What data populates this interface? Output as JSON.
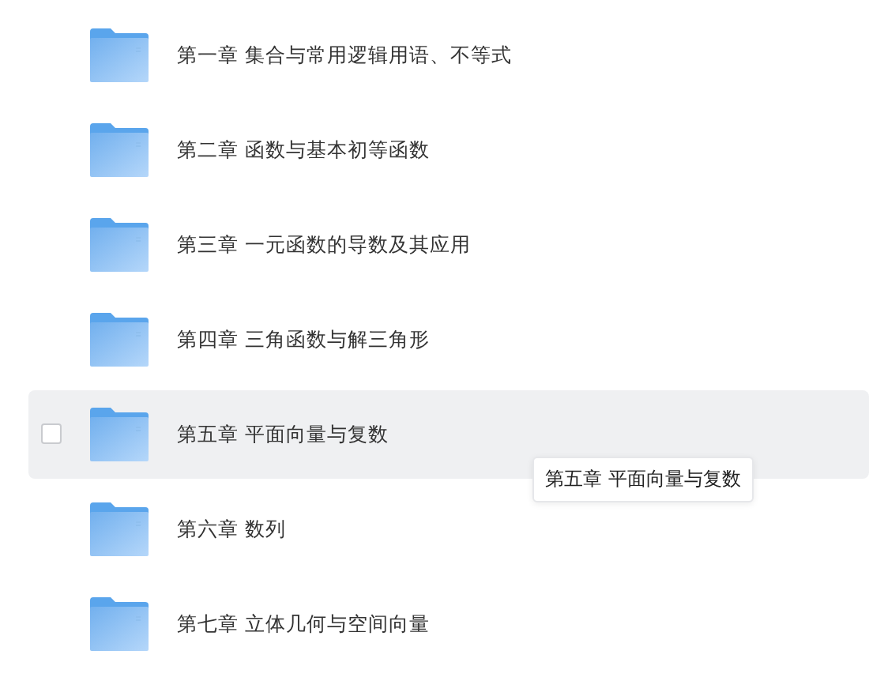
{
  "folders": [
    {
      "name": "第一章 集合与常用逻辑用语、不等式",
      "hovered": false
    },
    {
      "name": "第二章 函数与基本初等函数",
      "hovered": false
    },
    {
      "name": "第三章 一元函数的导数及其应用",
      "hovered": false
    },
    {
      "name": "第四章 三角函数与解三角形",
      "hovered": false
    },
    {
      "name": "第五章 平面向量与复数",
      "hovered": true,
      "checked": false,
      "tooltip": "第五章 平面向量与复数"
    },
    {
      "name": "第六章 数列",
      "hovered": false
    },
    {
      "name": "第七章 立体几何与空间向量",
      "hovered": false
    }
  ]
}
